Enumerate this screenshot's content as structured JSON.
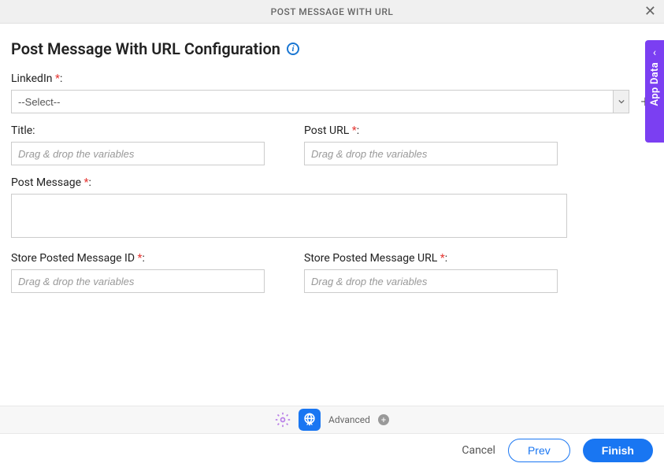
{
  "header": {
    "title": "POST MESSAGE WITH URL"
  },
  "page": {
    "title": "Post Message With URL Configuration"
  },
  "fields": {
    "linkedin": {
      "label": "LinkedIn ",
      "required": "*",
      "colon": ":",
      "value": "--Select--"
    },
    "title": {
      "label": "Title:",
      "placeholder": "Drag & drop the variables"
    },
    "post_url": {
      "label": "Post URL ",
      "required": "*",
      "colon": ":",
      "placeholder": "Drag & drop the variables"
    },
    "post_message": {
      "label": "Post Message ",
      "required": "*",
      "colon": ":"
    },
    "store_message_id": {
      "label": "Store Posted Message ID ",
      "required": "*",
      "colon": ":",
      "placeholder": "Drag & drop the variables"
    },
    "store_message_url": {
      "label": "Store Posted Message URL ",
      "required": "*",
      "colon": ":",
      "placeholder": "Drag & drop the variables"
    }
  },
  "side_tab": {
    "label": "App Data"
  },
  "toolbar": {
    "advanced_label": "Advanced"
  },
  "footer": {
    "cancel": "Cancel",
    "prev": "Prev",
    "finish": "Finish"
  }
}
